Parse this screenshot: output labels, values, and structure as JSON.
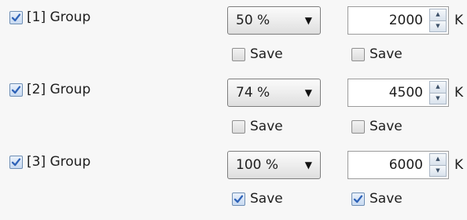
{
  "rows": [
    {
      "group_label": "[1] Group",
      "group_checked": true,
      "percent": "50 %",
      "value": "2000",
      "unit": "K",
      "save_a_label": "Save",
      "save_a_checked": false,
      "save_b_label": "Save",
      "save_b_checked": false
    },
    {
      "group_label": "[2] Group",
      "group_checked": true,
      "percent": "74 %",
      "value": "4500",
      "unit": "K",
      "save_a_label": "Save",
      "save_a_checked": false,
      "save_b_label": "Save",
      "save_b_checked": false
    },
    {
      "group_label": "[3] Group",
      "group_checked": true,
      "percent": "100 %",
      "value": "6000",
      "unit": "K",
      "save_a_label": "Save",
      "save_a_checked": true,
      "save_b_label": "Save",
      "save_b_checked": true
    }
  ],
  "icons": {
    "checkbox_checked": "checkmark-icon",
    "dropdown": "chevron-down-icon",
    "spin_up": "spin-up-icon",
    "spin_down": "spin-down-icon"
  },
  "colors": {
    "check": "#2f63b8",
    "panel": "#f7f7f7"
  }
}
